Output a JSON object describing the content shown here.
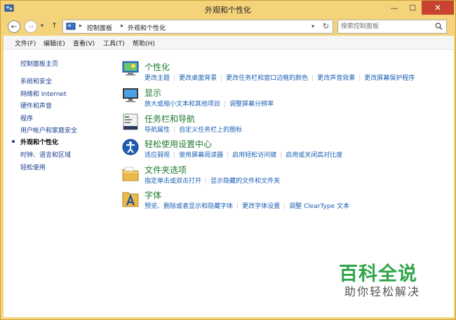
{
  "window": {
    "title": "外观和个性化"
  },
  "address": {
    "crumbs": [
      "控制面板",
      "外观和个性化"
    ],
    "search_placeholder": "搜索控制面板"
  },
  "menu": [
    "文件(F)",
    "编辑(E)",
    "查看(V)",
    "工具(T)",
    "帮助(H)"
  ],
  "sidebar": {
    "items": [
      {
        "label": "控制面板主页"
      },
      {
        "label": "系统和安全"
      },
      {
        "label": "网络和 Internet"
      },
      {
        "label": "硬件和声音"
      },
      {
        "label": "程序"
      },
      {
        "label": "用户帐户和家庭安全"
      },
      {
        "label": "外观和个性化",
        "current": true
      },
      {
        "label": "时钟、语言和区域"
      },
      {
        "label": "轻松使用"
      }
    ]
  },
  "categories": [
    {
      "title": "个性化",
      "icon": "personalization-icon",
      "links": [
        "更改主题",
        "更改桌面背景",
        "更改任务栏和窗口边框的颜色",
        "更改声音效果",
        "更改屏幕保护程序"
      ]
    },
    {
      "title": "显示",
      "icon": "display-icon",
      "links": [
        "放大或缩小文本和其他项目",
        "调整屏幕分辨率"
      ]
    },
    {
      "title": "任务栏和导航",
      "icon": "taskbar-icon",
      "links": [
        "导航属性",
        "自定义任务栏上的图标"
      ]
    },
    {
      "title": "轻松使用设置中心",
      "icon": "ease-of-access-icon",
      "links": [
        "适应弱视",
        "使用屏幕阅读器",
        "启用轻松访问键",
        "启用或关闭高对比度"
      ]
    },
    {
      "title": "文件夹选项",
      "icon": "folder-options-icon",
      "links": [
        "指定单击或双击打开",
        "显示隐藏的文件和文件夹"
      ]
    },
    {
      "title": "字体",
      "icon": "fonts-icon",
      "links": [
        "预览、删除或者显示和隐藏字体",
        "更改字体设置",
        "调整 ClearType 文本"
      ]
    }
  ],
  "watermark": {
    "main": "百科全说",
    "sub": "助你轻松解决"
  }
}
